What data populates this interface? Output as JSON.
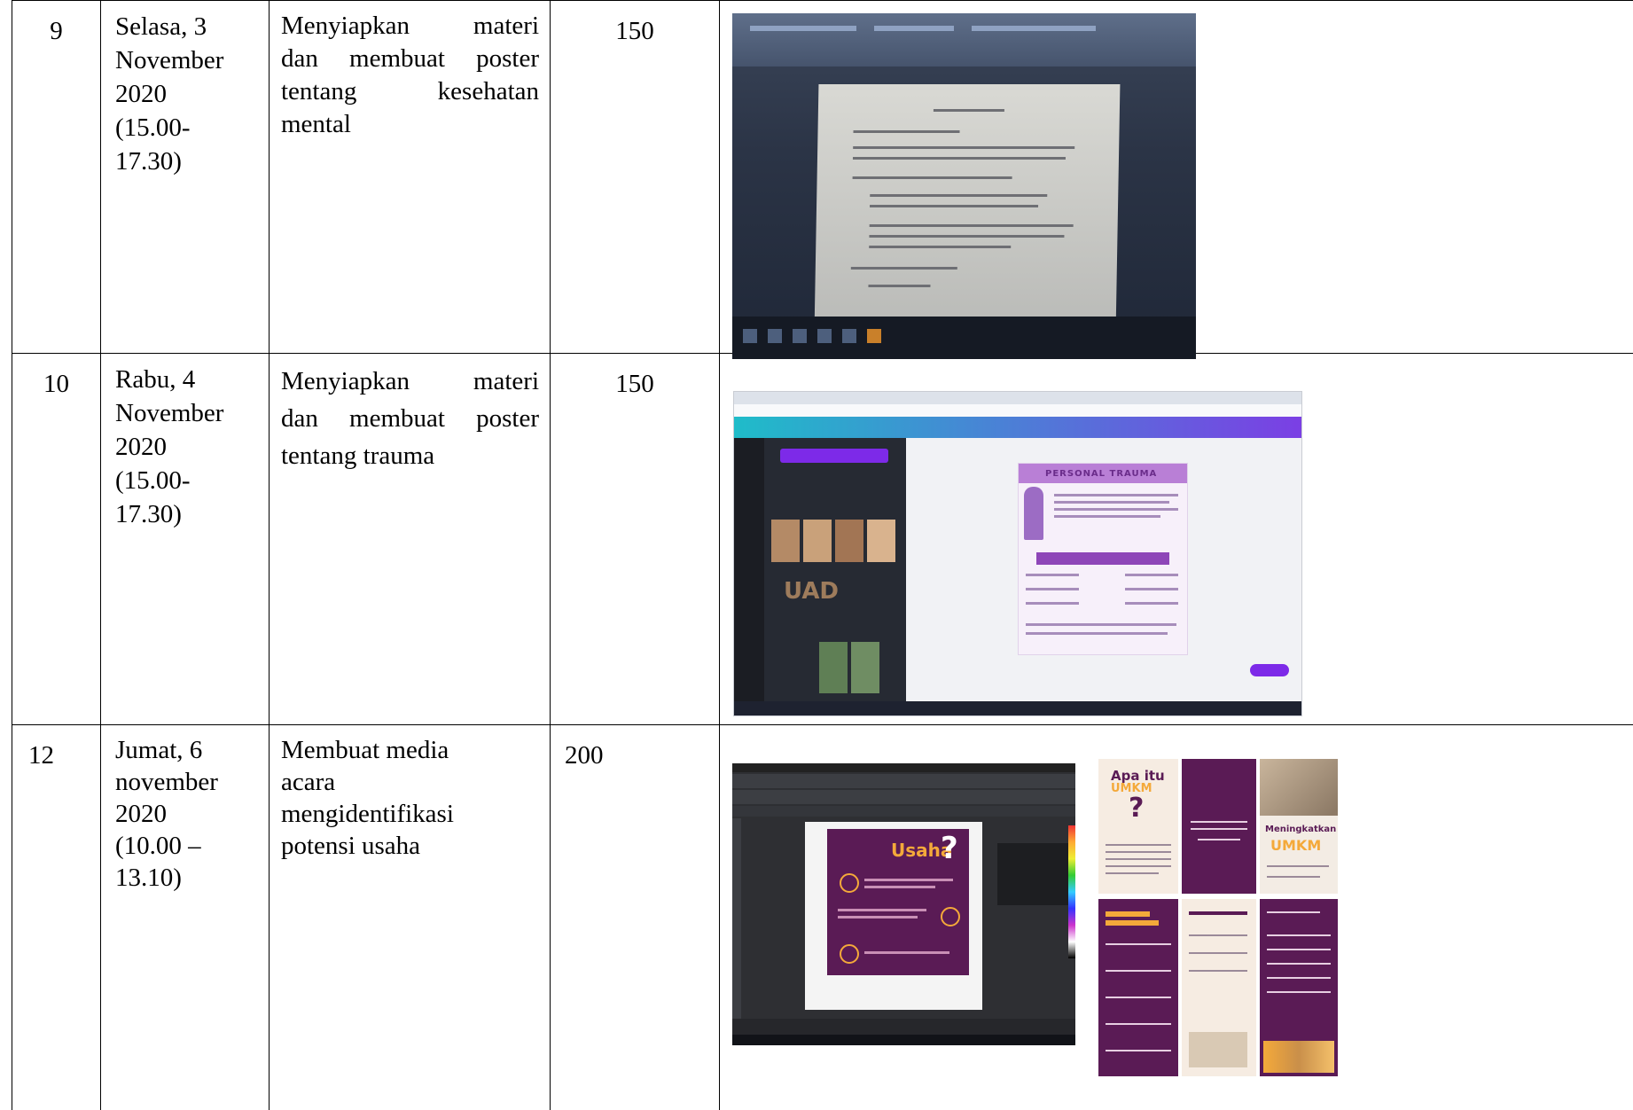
{
  "rows": [
    {
      "no": "9",
      "date_lines": [
        "Selasa, 3",
        "November",
        "2020",
        "(15.00-",
        "17.30)"
      ],
      "activity_lines": [
        "Menyiapkan materi",
        "dan membuat poster",
        "tentang kesehatan",
        "mental"
      ],
      "duration": "150"
    },
    {
      "no": "10",
      "date_lines": [
        "Rabu, 4",
        "November",
        "2020",
        "(15.00-",
        "17.30)"
      ],
      "activity_lines": [
        "Menyiapkan materi",
        "dan membuat poster",
        "tentang trauma"
      ],
      "duration": "150"
    },
    {
      "no": "12",
      "date_lines": [
        "Jumat, 6",
        "november",
        "2020",
        "(10.00 –",
        "13.10)"
      ],
      "activity_lines": [
        "Membuat media",
        "acara",
        "mengidentifikasi",
        "potensi usaha"
      ],
      "duration": "200"
    }
  ],
  "images": {
    "canva_poster_title": "PERSONAL TRAUMA",
    "canva_brand": "UAD",
    "corel_title": "Usaha",
    "corel_mark": "?",
    "brochure_heading_1": "Apa itu",
    "brochure_heading_2": "UMKM",
    "brochure_mark": "?",
    "brochure_right_1": "Meningkatkan",
    "brochure_right_2": "UMKM"
  }
}
